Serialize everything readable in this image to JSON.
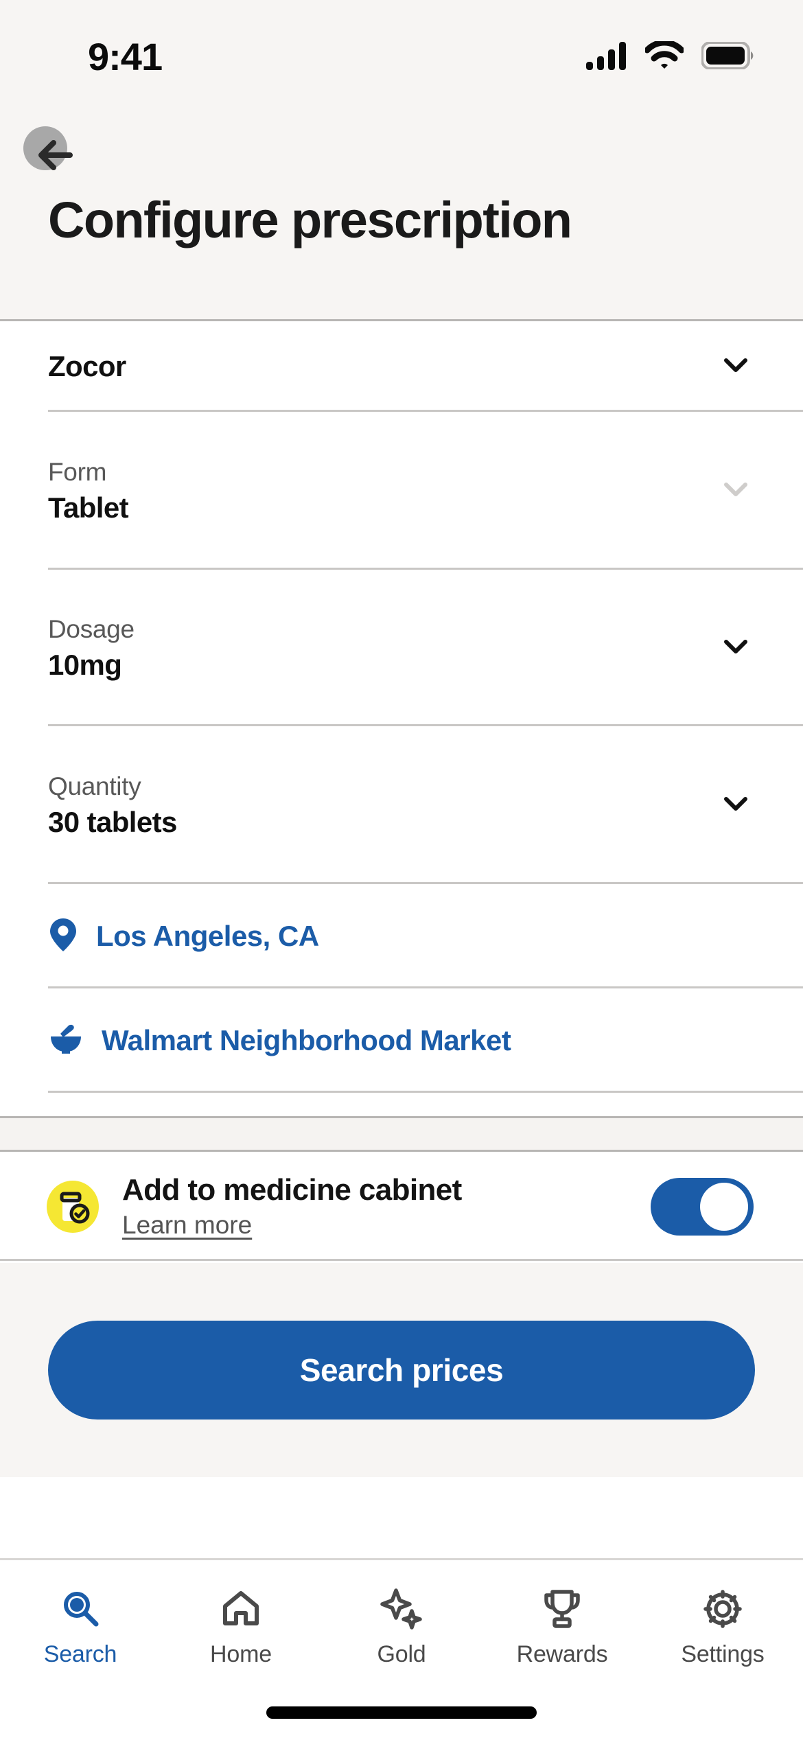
{
  "status_bar": {
    "time": "9:41",
    "icons": [
      "cellular-signal-icon",
      "wifi-icon",
      "battery-icon"
    ]
  },
  "header": {
    "back_icon": "back-arrow-icon",
    "title": "Configure prescription"
  },
  "form": {
    "drug": {
      "value": "Zocor",
      "chevron": "chevron-down-icon",
      "enabled": true
    },
    "fields": [
      {
        "label": "Form",
        "value": "Tablet",
        "chevron": "chevron-down-icon",
        "enabled": false
      },
      {
        "label": "Dosage",
        "value": "10mg",
        "chevron": "chevron-down-icon",
        "enabled": true
      },
      {
        "label": "Quantity",
        "value": "30 tablets",
        "chevron": "chevron-down-icon",
        "enabled": true
      }
    ],
    "links": [
      {
        "icon": "location-pin-icon",
        "text": "Los Angeles, CA"
      },
      {
        "icon": "mortar-and-pestle-icon",
        "text": "Walmart Neighborhood Market"
      }
    ]
  },
  "medicine_cabinet": {
    "icon": "pill-bottle-check-icon",
    "title": "Add to medicine cabinet",
    "learn_more": "Learn more",
    "toggle_on": true
  },
  "cta": {
    "label": "Search prices"
  },
  "tab_bar": {
    "active": "Search",
    "tabs": [
      {
        "label": "Search",
        "icon": "search-icon"
      },
      {
        "label": "Home",
        "icon": "home-icon"
      },
      {
        "label": "Gold",
        "icon": "sparkles-icon"
      },
      {
        "label": "Rewards",
        "icon": "trophy-icon"
      },
      {
        "label": "Settings",
        "icon": "gear-icon"
      }
    ]
  },
  "colors": {
    "accent_blue": "#1B5CA8",
    "badge_yellow": "#F5E733",
    "header_bg": "#F7F5F3",
    "text_dark": "#101010",
    "text_muted": "#585858"
  }
}
